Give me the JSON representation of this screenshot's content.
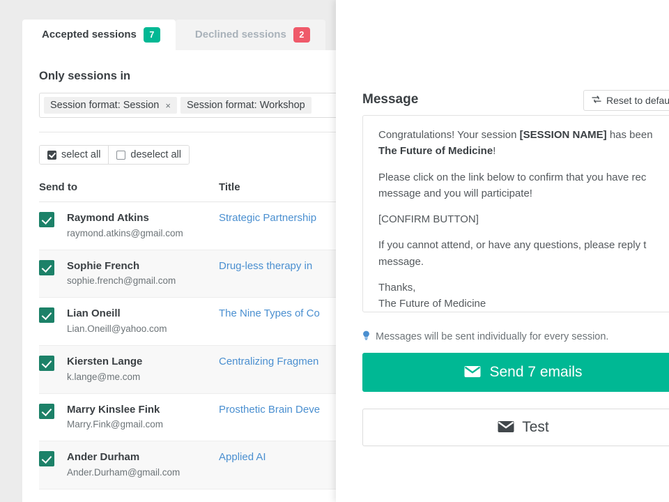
{
  "tabs": [
    {
      "label": "Accepted sessions",
      "count": "7",
      "badge_color": "#00b894",
      "active": true
    },
    {
      "label": "Declined sessions",
      "count": "2",
      "badge_color": "#ef5a6a",
      "active": false
    }
  ],
  "filter": {
    "label": "Only sessions in",
    "chips": [
      {
        "text": "Session format: Session",
        "remove": "×"
      },
      {
        "text": "Session format: Workshop",
        "remove": "×"
      }
    ]
  },
  "selection": {
    "select_all": "select all",
    "deselect_all": "deselect all"
  },
  "table": {
    "headers": {
      "send_to": "Send to",
      "title": "Title"
    },
    "rows": [
      {
        "name": "Raymond Atkins",
        "email": "raymond.atkins@gmail.com",
        "title": "Strategic Partnership",
        "checked": true
      },
      {
        "name": "Sophie French",
        "email": "sophie.french@gmail.com",
        "title": "Drug-less therapy in",
        "checked": true
      },
      {
        "name": "Lian Oneill",
        "email": "Lian.Oneill@yahoo.com",
        "title": "The Nine Types of Co",
        "checked": true
      },
      {
        "name": "Kiersten Lange",
        "email": "k.lange@me.com",
        "title": "Centralizing Fragmen",
        "checked": true
      },
      {
        "name": "Marry Kinslee Fink",
        "email": "Marry.Fink@gmail.com",
        "title": "Prosthetic Brain Deve",
        "checked": true
      },
      {
        "name": "Ander Durham",
        "email": "Ander.Durham@gmail.com",
        "title": "Applied AI",
        "checked": true
      }
    ]
  },
  "message_panel": {
    "title": "Message",
    "reset_label": "Reset to defaul",
    "body": {
      "p1_pre": "Congratulations! Your session ",
      "p1_session": "[SESSION NAME]",
      "p1_mid": " has been",
      "p1_org": "The Future of Medicine",
      "p1_end": "!",
      "p2_line1": "Please click on the link below to confirm that you have rec",
      "p2_line2": "message and you will participate!",
      "p3": "[CONFIRM BUTTON]",
      "p4_line1": "If you cannot attend, or have any questions, please reply t",
      "p4_line2": "message.",
      "p5_line1": "Thanks,",
      "p5_line2": "The Future of Medicine"
    },
    "hint": "Messages will be sent individually for every session.",
    "send_label": "Send 7 emails",
    "test_label": "Test"
  },
  "colors": {
    "accent_green": "#00b894",
    "checkbox_green": "#1c8168",
    "danger_red": "#ef5a6a",
    "link_blue": "#4a8fd0",
    "page_bg": "#ececec"
  }
}
